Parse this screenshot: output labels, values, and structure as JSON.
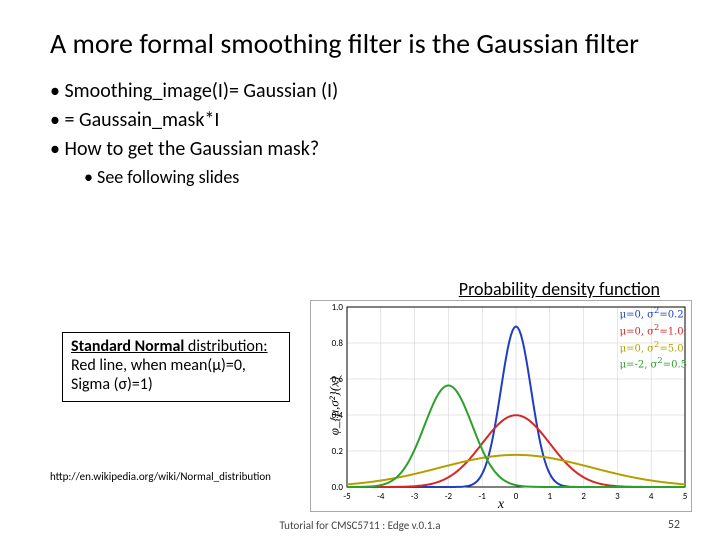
{
  "title": "A more formal smoothing  filter is the Gaussian filter",
  "bullets": {
    "b1": "Smoothing_image(I)= Gaussian (I)",
    "b2": "= Gaussain_mask*I",
    "b3": "How to get the Gaussian mask?",
    "b3a": "See following slides"
  },
  "pdf_label": "Probability density function",
  "note": {
    "l1": "Standard",
    "l2": " Normal ",
    "l3": "distribution:",
    "rest": " Red line, when mean(μ)=0, Sigma (σ)=1)"
  },
  "cite": "http://en.wikipedia.org/wiki/Normal_distribution",
  "footer": "Tutorial for CMSC5711 : Edge v.0.1.a",
  "page_number": "52",
  "chart_data": {
    "type": "line",
    "title": "Probability density function",
    "xlabel": "x",
    "ylabel": "φ_{μ,σ²}(x)",
    "xlim": [
      -5,
      5
    ],
    "ylim": [
      0,
      1.0
    ],
    "xticks": [
      -5,
      -4,
      -3,
      -2,
      -1,
      0,
      1,
      2,
      3,
      4,
      5
    ],
    "yticks": [
      0.0,
      0.2,
      0.4,
      0.6,
      0.8,
      1.0
    ],
    "series": [
      {
        "name": "μ=0, σ²=0.2",
        "color": "#1f3fbf",
        "mu": 0,
        "sigma2": 0.2
      },
      {
        "name": "μ=0, σ²=1.0",
        "color": "#d62728",
        "mu": 0,
        "sigma2": 1.0
      },
      {
        "name": "μ=0, σ²=5.0",
        "color": "#b3a000",
        "mu": 0,
        "sigma2": 5.0
      },
      {
        "name": "μ=-2, σ²=0.5",
        "color": "#2ca02c",
        "mu": -2,
        "sigma2": 0.5
      }
    ]
  }
}
